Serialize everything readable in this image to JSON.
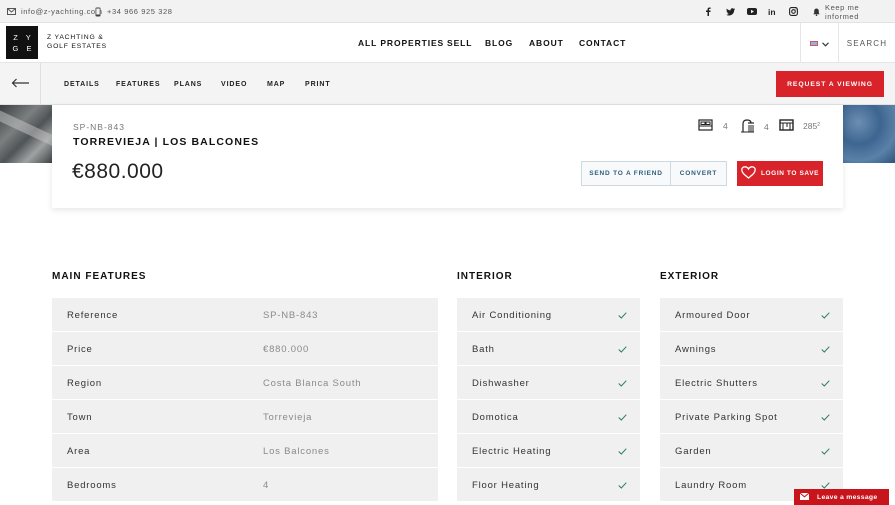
{
  "topbar": {
    "email": "info@z-yachting.com",
    "phone": "+34 966 925 328",
    "social_icons": [
      "facebook-icon",
      "twitter-icon",
      "youtube-icon",
      "linkedin-icon",
      "instagram-icon"
    ],
    "notify_label": "Keep me informed"
  },
  "header": {
    "logo_letters": [
      "Z Y",
      "G E"
    ],
    "logo_text": "Z YACHTING & GOLF ESTATES",
    "nav": [
      "ALL PROPERTIES",
      "SELL",
      "BLOG",
      "ABOUT",
      "CONTACT"
    ],
    "search_label": "SEARCH"
  },
  "subnav": {
    "items": [
      "DETAILS",
      "FEATURES",
      "PLANS",
      "VIDEO",
      "MAP",
      "PRINT"
    ],
    "request_label": "REQUEST A VIEWING"
  },
  "property": {
    "reference": "SP-NB-843",
    "location": "TORREVIEJA | LOS BALCONES",
    "price": "€880.000",
    "bedrooms": "4",
    "bathrooms": "4",
    "area": "285",
    "area_unit": "2",
    "send_label": "SEND TO A FRIEND",
    "convert_label": "CONVERT",
    "save_label": "LOGIN TO SAVE"
  },
  "main_features": {
    "title": "MAIN FEATURES",
    "rows": [
      {
        "k": "Reference",
        "v": "SP-NB-843"
      },
      {
        "k": "Price",
        "v": "€880.000"
      },
      {
        "k": "Region",
        "v": "Costa Blanca South"
      },
      {
        "k": "Town",
        "v": "Torrevieja"
      },
      {
        "k": "Area",
        "v": "Los Balcones"
      },
      {
        "k": "Bedrooms",
        "v": "4"
      }
    ]
  },
  "interior": {
    "title": "INTERIOR",
    "items": [
      "Air Conditioning",
      "Bath",
      "Dishwasher",
      "Domotica",
      "Electric Heating",
      "Floor Heating"
    ]
  },
  "exterior": {
    "title": "EXTERIOR",
    "items": [
      "Armoured Door",
      "Awnings",
      "Electric Shutters",
      "Private Parking Spot",
      "Garden",
      "Laundry Room"
    ]
  },
  "chat": {
    "label": "Leave a message"
  },
  "colors": {
    "accent": "#d8232a",
    "link": "#2f5d7e",
    "row_bg": "#f0f0f0"
  }
}
